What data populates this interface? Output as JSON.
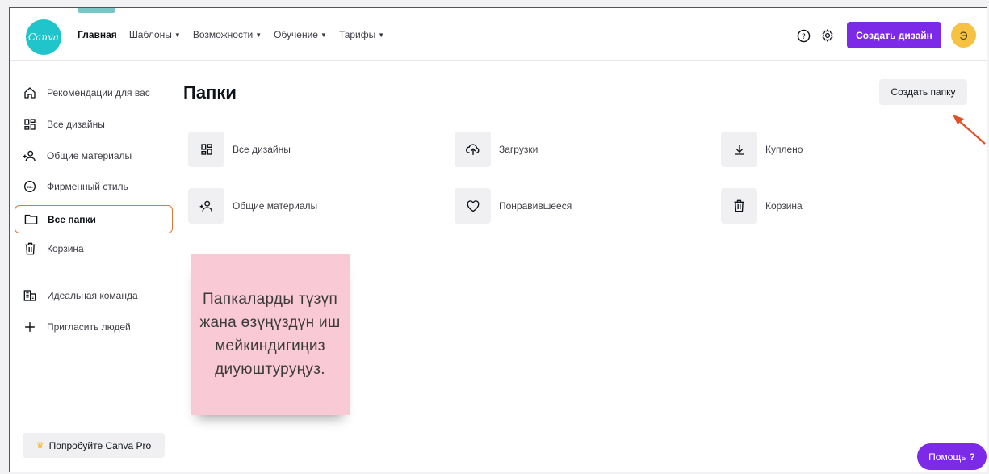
{
  "header": {
    "logo_text": "Canva",
    "nav": [
      {
        "label": "Главная"
      },
      {
        "label": "Шаблоны"
      },
      {
        "label": "Возможности"
      },
      {
        "label": "Обучение"
      },
      {
        "label": "Тарифы"
      }
    ],
    "create_design_label": "Создать дизайн",
    "avatar_letter": "Э"
  },
  "sidebar": {
    "items": [
      {
        "label": "Рекомендации для вас",
        "icon": "home-icon"
      },
      {
        "label": "Все дизайны",
        "icon": "grid-icon"
      },
      {
        "label": "Общие материалы",
        "icon": "shared-people-icon"
      },
      {
        "label": "Фирменный стиль",
        "icon": "brand-kit-icon"
      },
      {
        "label": "Все папки",
        "icon": "folder-icon",
        "active": true
      },
      {
        "label": "Корзина",
        "icon": "trash-icon"
      },
      {
        "label": "Идеальная команда",
        "icon": "team-building-icon"
      },
      {
        "label": "Пригласить людей",
        "icon": "plus-icon"
      }
    ],
    "try_pro_label": "Попробуйте Canva Pro"
  },
  "main": {
    "title": "Папки",
    "create_folder_label": "Создать папку",
    "folders": [
      {
        "label": "Все дизайны",
        "icon": "grid-icon"
      },
      {
        "label": "Загрузки",
        "icon": "cloud-upload-icon"
      },
      {
        "label": "Куплено",
        "icon": "download-icon"
      },
      {
        "label": "Общие материалы",
        "icon": "shared-people-icon"
      },
      {
        "label": "Понравившееся",
        "icon": "heart-icon"
      },
      {
        "label": "Корзина",
        "icon": "trash-icon"
      }
    ]
  },
  "annotation": {
    "text": "Папкаларды түзүп жана өзүңүздүн иш мейкиндигиңиз диуюштуруңуз."
  },
  "help": {
    "label": "Помощь",
    "mark": "?"
  },
  "colors": {
    "brand_purple": "#7d2ae8",
    "logo_teal": "#20c4cb",
    "active_outline": "#e0763a",
    "arrow": "#e0502a",
    "sticky_note": "#f9cad6",
    "avatar": "#f5c242"
  }
}
